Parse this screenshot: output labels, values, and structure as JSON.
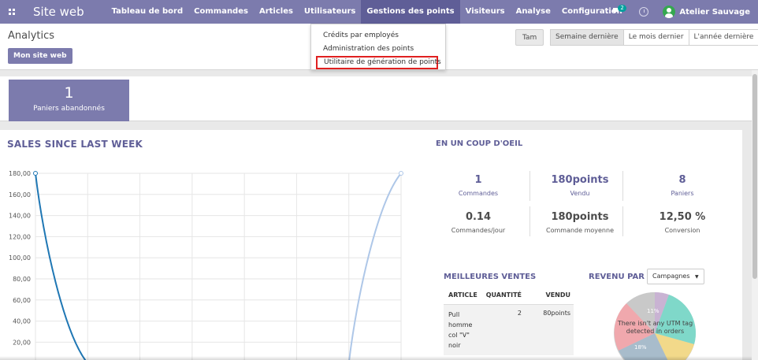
{
  "navbar": {
    "brand": "Site web",
    "menu": [
      {
        "label": "Tableau de bord"
      },
      {
        "label": "Commandes"
      },
      {
        "label": "Articles"
      },
      {
        "label": "Utilisateurs"
      },
      {
        "label": "Gestions des points",
        "active": true
      },
      {
        "label": "Visiteurs"
      },
      {
        "label": "Analyse"
      },
      {
        "label": "Configuration"
      }
    ],
    "chat_badge": "2",
    "user_name": "Atelier Sauvage"
  },
  "dropdown": {
    "items": [
      "Crédits par employés",
      "Administration des points",
      "Utilitaire de génération de points"
    ],
    "highlighted_index": 2
  },
  "control_panel": {
    "title": "Analytics",
    "site_button": "Mon site web",
    "tam_button": "Tam",
    "periods": [
      "Semaine dernière",
      "Le mois dernier",
      "L'année dernière"
    ],
    "active_period": "Semaine dernière"
  },
  "summary": {
    "value": "1",
    "label": "Paniers abandonnés"
  },
  "sales": {
    "title": "SALES SINCE LAST WEEK"
  },
  "chart_data": {
    "type": "line",
    "title": "SALES SINCE LAST WEEK",
    "y_ticks": [
      "180,00",
      "160,00",
      "140,00",
      "120,00",
      "100,00",
      "80,00",
      "60,00",
      "40,00",
      "20,00"
    ],
    "ylim": [
      0,
      180
    ],
    "series": [
      {
        "values_x": [
          0,
          1
        ],
        "values_y": [
          180,
          0
        ],
        "color": "#1f77b4"
      },
      {
        "values_x": [
          6,
          7
        ],
        "values_y": [
          0,
          180
        ],
        "color": "#aec7e8"
      }
    ],
    "grid": true
  },
  "glance": {
    "title": "EN UN COUP D'OEIL",
    "stats": [
      {
        "value": "1",
        "label": "Commandes",
        "link": true
      },
      {
        "value": "180points",
        "label": "Vendu",
        "link": true
      },
      {
        "value": "8",
        "label": "Paniers",
        "link": true
      },
      {
        "value": "0.14",
        "label": "Commandes/jour",
        "link": false
      },
      {
        "value": "180points",
        "label": "Commande moyenne",
        "link": false
      },
      {
        "value": "12,50 %",
        "label": "Conversion",
        "link": false
      }
    ]
  },
  "best_sales": {
    "title": "MEILLEURES VENTES",
    "headers": [
      "ARTICLE",
      "QUANTITÉ",
      "VENDU"
    ],
    "rows": [
      {
        "article_lines": [
          "Pull",
          "homme",
          "col \"V\"",
          "noir"
        ],
        "quantity": "2",
        "sold": "80points"
      }
    ]
  },
  "revenue": {
    "title": "REVENU PAR",
    "select_value": "Campagnes",
    "empty_message": "There isn't any UTM tag detected in orders",
    "pie_labels": [
      "11%",
      "18%"
    ]
  }
}
